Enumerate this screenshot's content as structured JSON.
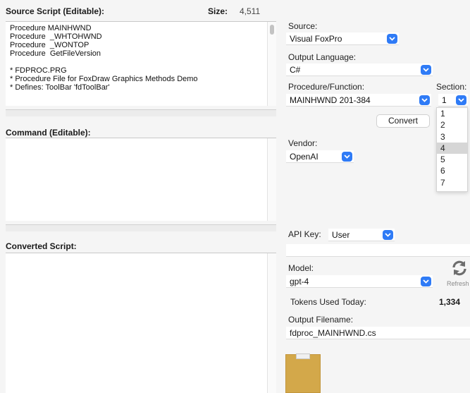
{
  "source_script": {
    "label": "Source Script (Editable):",
    "size_label": "Size:",
    "size_value": "4,511",
    "lines": [
      "Procedure MAINHWND",
      "Procedure  _WHTOHWND",
      "Procedure  _WONTOP",
      "Procedure  GetFileVersion",
      "",
      "* FDPROC.PRG",
      "* Procedure File for FoxDraw Graphics Methods Demo",
      "* Defines: ToolBar 'fdToolBar'"
    ]
  },
  "command": {
    "label": "Command (Editable):"
  },
  "converted": {
    "label": "Converted Script:"
  },
  "source": {
    "label": "Source:",
    "value": "Visual FoxPro"
  },
  "output_language": {
    "label": "Output Language:",
    "value": "C#"
  },
  "procedure": {
    "label": "Procedure/Function:",
    "value": "MAINHWND 201-384"
  },
  "section": {
    "label": "Section:",
    "value": "1",
    "options": [
      "1",
      "2",
      "3",
      "4",
      "5",
      "6",
      "7"
    ],
    "highlighted": "4"
  },
  "convert_button": "Convert",
  "vendor": {
    "label": "Vendor:",
    "value": "OpenAI"
  },
  "api_key": {
    "label": "API Key:",
    "value": "User"
  },
  "model": {
    "label": "Model:",
    "value": "gpt-4"
  },
  "refresh": {
    "label": "Refresh",
    "icon": "refresh-icon"
  },
  "tokens": {
    "label": "Tokens Used Today:",
    "value": "1,334"
  },
  "output_filename": {
    "label": "Output Filename:",
    "value": "fdproc_MAINHWND.cs"
  },
  "colors": {
    "accent": "#2f7bf6",
    "background": "#f5f5f5",
    "folder_icon": "#d3a84a"
  }
}
